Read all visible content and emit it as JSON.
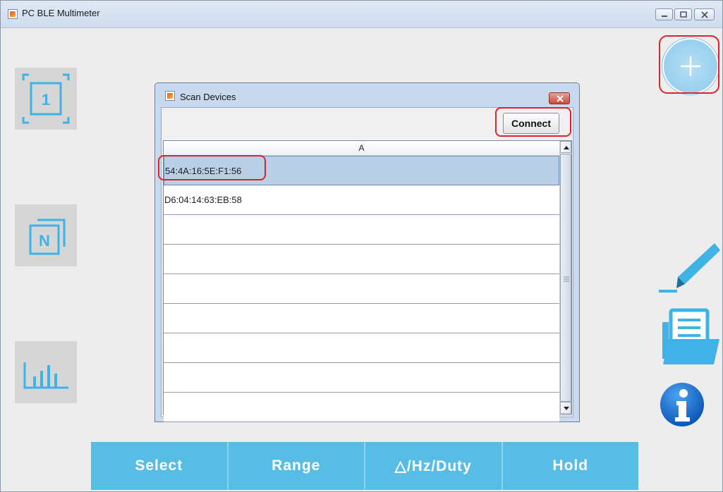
{
  "window": {
    "title": "PC BLE Multimeter",
    "controls": [
      "minimize",
      "maximize",
      "close"
    ]
  },
  "left_toolbar": [
    {
      "name": "single-view",
      "label": "1",
      "icon": "single-view-icon"
    },
    {
      "name": "multi-view",
      "label": "N",
      "icon": "multi-view-icon"
    },
    {
      "name": "chart-view",
      "label": "",
      "icon": "bar-chart-icon"
    }
  ],
  "right_toolbar": [
    {
      "name": "add-device",
      "icon": "plus-icon"
    },
    {
      "name": "edit",
      "icon": "highlighter-icon"
    },
    {
      "name": "open-file",
      "icon": "folder-document-icon"
    },
    {
      "name": "about",
      "icon": "info-icon"
    }
  ],
  "bottom_bar": {
    "buttons": [
      "Select",
      "Range",
      "△/Hz/Duty",
      "Hold"
    ]
  },
  "dialog": {
    "title": "Scan Devices",
    "connect_label": "Connect",
    "column_header": "A",
    "rows": [
      "54:4A:16:5E:F1:56",
      "D6:04:14:63:EB:58",
      "",
      "",
      "",
      "",
      "",
      "",
      ""
    ],
    "selected_row": 0
  },
  "colors": {
    "accent": "#58bde5",
    "icon_blue": "#3fb2e6",
    "highlight_red": "#e0202a",
    "selection": "#b8cfe5",
    "info_blue": "#1b6fcf"
  }
}
